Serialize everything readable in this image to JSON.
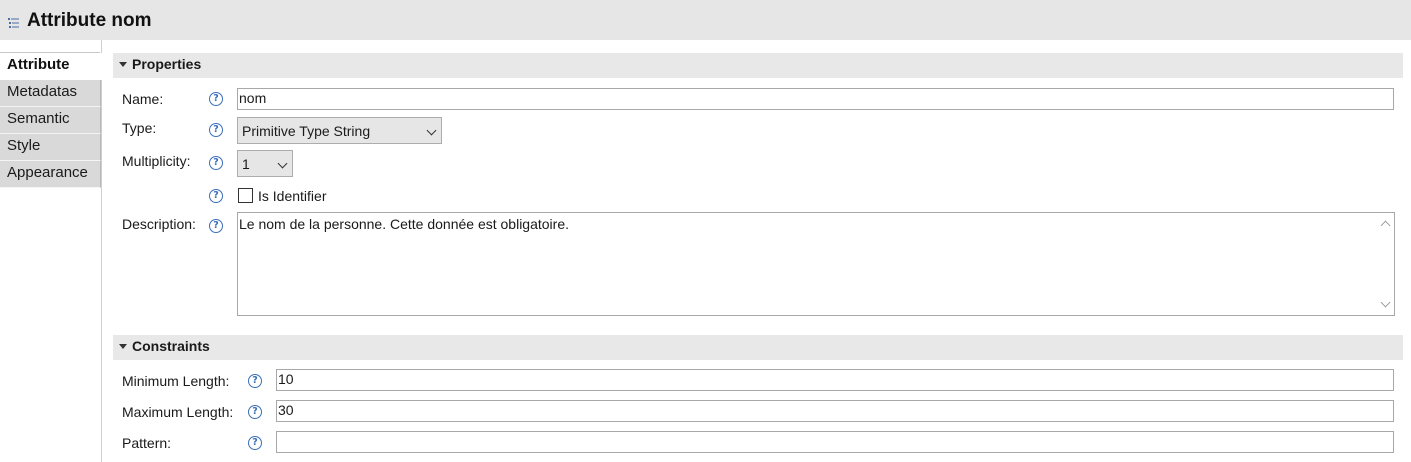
{
  "header": {
    "title": "Attribute nom",
    "icon": "list-icon"
  },
  "tabs": [
    {
      "label": "Attribute",
      "active": true
    },
    {
      "label": "Metadatas",
      "active": false
    },
    {
      "label": "Semantic",
      "active": false
    },
    {
      "label": "Style",
      "active": false
    },
    {
      "label": "Appearance",
      "active": false
    }
  ],
  "properties": {
    "title": "Properties",
    "name": {
      "label": "Name:",
      "value": "nom"
    },
    "type": {
      "label": "Type:",
      "value": "Primitive Type String"
    },
    "multiplicity": {
      "label": "Multiplicity:",
      "value": "1"
    },
    "identifier": {
      "label": "Is Identifier",
      "checked": false
    },
    "description": {
      "label": "Description:",
      "value": "Le nom de la personne. Cette donnée est obligatoire."
    }
  },
  "constraints": {
    "title": "Constraints",
    "min_length": {
      "label": "Minimum Length:",
      "value": "10"
    },
    "max_length": {
      "label": "Maximum Length:",
      "value": "30"
    },
    "pattern": {
      "label": "Pattern:",
      "value": ""
    }
  },
  "help_glyph": "?",
  "colors": {
    "help": "#3a6fb7",
    "header_bg": "#e6e6e6",
    "section_bg": "#e8e8e8",
    "tab_bg": "#d9d9d9"
  }
}
